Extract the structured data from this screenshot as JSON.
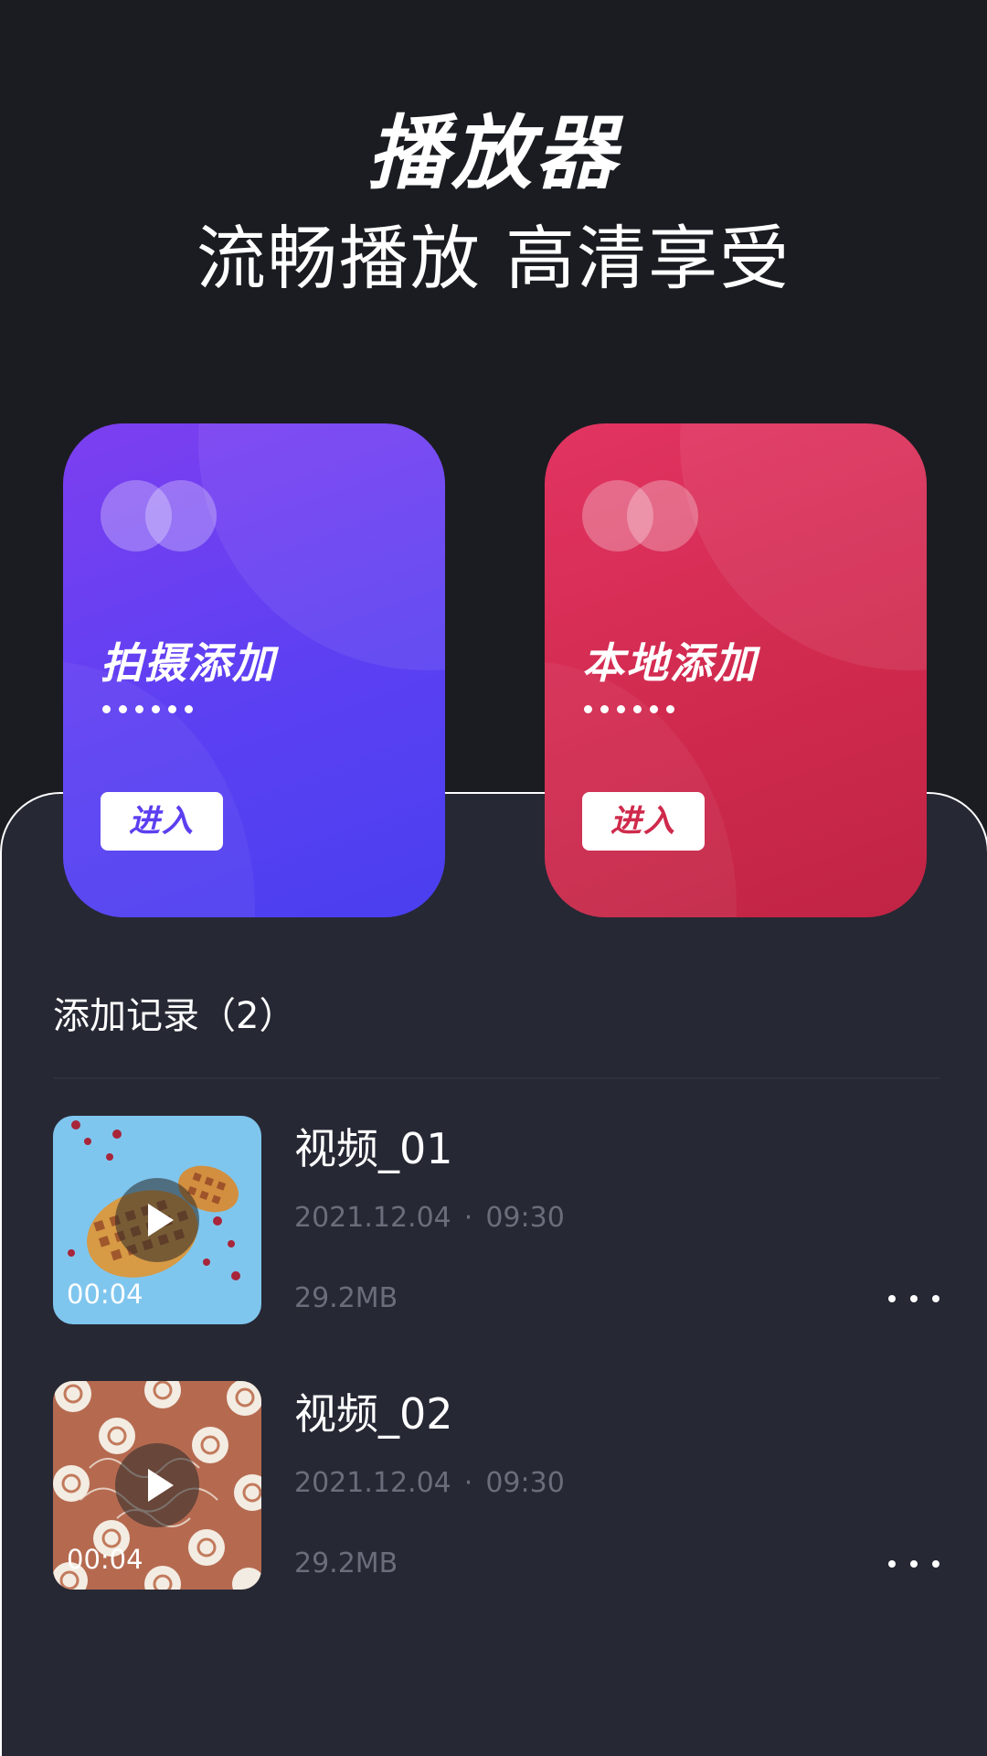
{
  "header": {
    "title": "播放器",
    "subtitle": "流畅播放 高清享受"
  },
  "cards": [
    {
      "label": "拍摄添加",
      "button": "进入",
      "color": "#6a40f1"
    },
    {
      "label": "本地添加",
      "button": "进入",
      "color": "#d42c52"
    }
  ],
  "records": {
    "title": "添加记录（2）",
    "items": [
      {
        "title": "视频_01",
        "date": "2021.12.04",
        "time": "09:30",
        "size": "29.2MB",
        "duration": "00:04",
        "thumbnail": "waffle-photo"
      },
      {
        "title": "视频_02",
        "date": "2021.12.04",
        "time": "09:30",
        "size": "29.2MB",
        "duration": "00:04",
        "thumbnail": "marshmallow-cups-photo"
      }
    ]
  },
  "icons": {
    "play": "play-icon",
    "more": "more-dots-icon",
    "card_logo": "overlapping-circles-icon"
  },
  "colors": {
    "background": "#1b1c21",
    "panel": "#262834",
    "muted_text": "#6b6e7a"
  }
}
